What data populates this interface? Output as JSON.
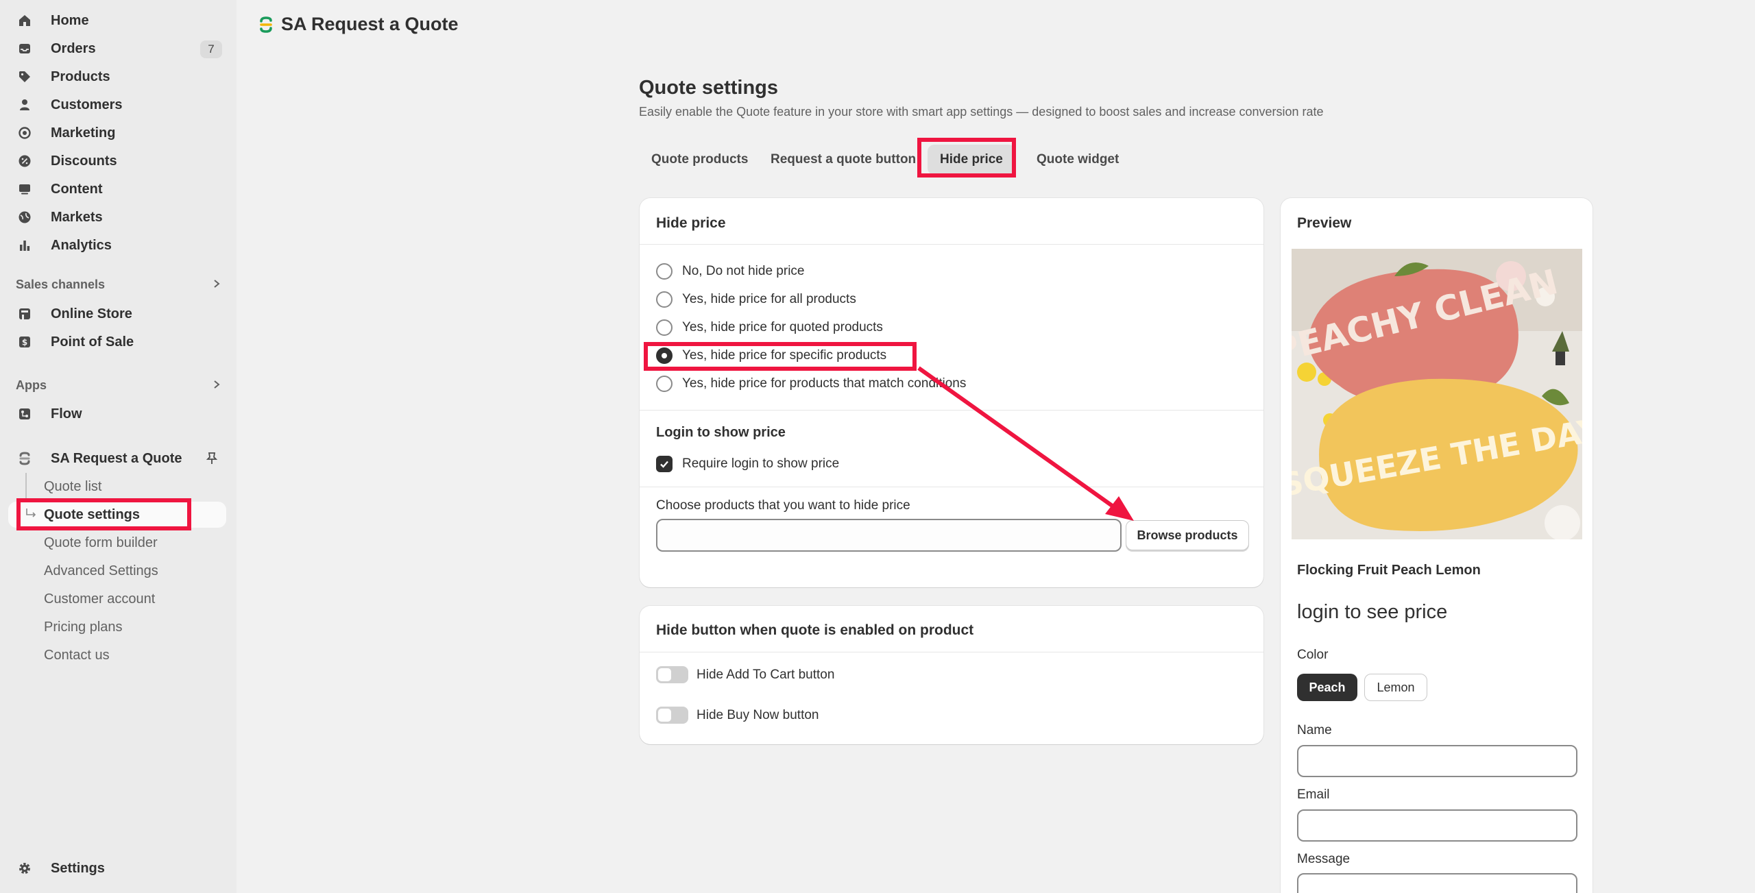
{
  "sidebar": {
    "items": [
      {
        "label": "Home",
        "icon": "home-icon"
      },
      {
        "label": "Orders",
        "icon": "inbox-icon",
        "badge": "7"
      },
      {
        "label": "Products",
        "icon": "tag-icon"
      },
      {
        "label": "Customers",
        "icon": "person-icon"
      },
      {
        "label": "Marketing",
        "icon": "target-icon"
      },
      {
        "label": "Discounts",
        "icon": "discount-icon"
      },
      {
        "label": "Content",
        "icon": "content-icon"
      },
      {
        "label": "Markets",
        "icon": "globe-icon"
      },
      {
        "label": "Analytics",
        "icon": "bar-chart-icon"
      }
    ],
    "sales_channels": {
      "header": "Sales channels",
      "items": [
        {
          "label": "Online Store",
          "icon": "store-icon"
        },
        {
          "label": "Point of Sale",
          "icon": "pos-icon"
        }
      ]
    },
    "apps": {
      "header": "Apps",
      "items": [
        {
          "label": "Flow",
          "icon": "flow-icon"
        }
      ]
    },
    "app": {
      "label": "SA Request a Quote",
      "pin_icon": "pin-icon",
      "sub_items": [
        {
          "label": "Quote list"
        },
        {
          "label": "Quote settings",
          "active": true
        },
        {
          "label": "Quote form builder"
        },
        {
          "label": "Advanced Settings"
        },
        {
          "label": "Customer account"
        },
        {
          "label": "Pricing plans"
        },
        {
          "label": "Contact us"
        }
      ]
    },
    "settings": {
      "label": "Settings",
      "icon": "gear-icon"
    }
  },
  "header": {
    "app_title": "SA Request a Quote"
  },
  "main": {
    "title": "Quote settings",
    "subtitle": "Easily enable the Quote feature in your store with smart app settings — designed to boost sales and increase conversion rate",
    "tabs": [
      {
        "label": "Quote products"
      },
      {
        "label": "Request a quote button"
      },
      {
        "label": "Hide price",
        "active": true
      },
      {
        "label": "Quote widget"
      }
    ],
    "hide_price_card": {
      "title": "Hide price",
      "options": [
        {
          "label": "No, Do not hide price",
          "selected": false
        },
        {
          "label": "Yes, hide price for all products",
          "selected": false
        },
        {
          "label": "Yes, hide price for quoted products",
          "selected": false
        },
        {
          "label": "Yes, hide price for specific products",
          "selected": true
        },
        {
          "label": "Yes, hide price for products that match conditions",
          "selected": false
        }
      ],
      "login_title": "Login to show price",
      "login_checkbox": {
        "label": "Require login to show price",
        "checked": true
      },
      "choose_label": "Choose products that you want to hide price",
      "choose_value": "",
      "browse_button": "Browse products"
    },
    "hide_button_card": {
      "title": "Hide button when quote is enabled on product",
      "toggles": [
        {
          "label": "Hide Add To Cart button",
          "on": false
        },
        {
          "label": "Hide Buy Now button",
          "on": false
        }
      ]
    }
  },
  "preview": {
    "title": "Preview",
    "image_text_top": "PEACHY CLEAN",
    "image_text_bottom": "SQUEEZE THE DAY",
    "product_name": "Flocking Fruit Peach Lemon",
    "price_text": "login to see price",
    "color_label": "Color",
    "color_options": [
      {
        "label": "Peach",
        "selected": true
      },
      {
        "label": "Lemon",
        "selected": false
      }
    ],
    "fields": [
      {
        "label": "Name",
        "value": ""
      },
      {
        "label": "Email",
        "value": ""
      },
      {
        "label": "Message",
        "value": ""
      }
    ]
  },
  "colors": {
    "highlight": "#ef1540",
    "sidebar_bg": "#ebebeb",
    "page_bg": "#f1f1f1",
    "primary_dark": "#303030"
  }
}
